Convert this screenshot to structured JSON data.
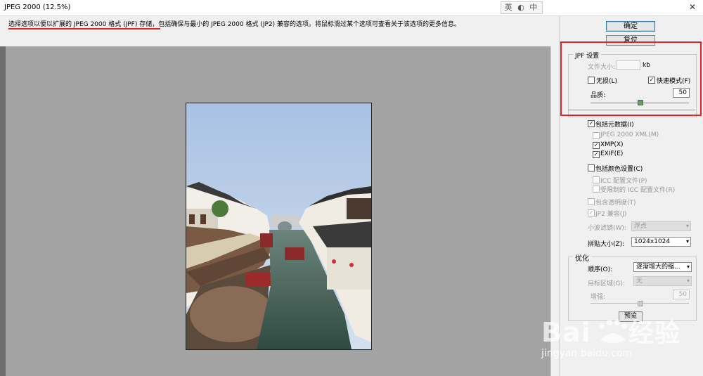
{
  "window": {
    "title": "JPEG 2000 (12.5%)",
    "ime_indicator": "英 ◐ 中",
    "close": "✕"
  },
  "hint_text": "选择选项以便以扩展的 JPEG 2000 格式 (JPF) 存储，包括确保与最小的 JPEG 2000 格式 (JP2) 兼容的选项。将鼠标滑过某个选项可查看关于该选项的更多信息。",
  "buttons": {
    "ok": "确定",
    "reset": "复位",
    "preview": "预览"
  },
  "jpf_settings": {
    "title": "JPF 设置",
    "file_size_label": "文件大小:",
    "file_size_value": "",
    "file_size_unit": "kb",
    "lossless_label": "无损(L)",
    "lossless_checked": false,
    "fast_mode_label": "快速模式(F)",
    "fast_mode_checked": true,
    "quality_label": "品质:",
    "quality_value": "50",
    "quality_level": 0.5
  },
  "metadata": {
    "include_metadata_label": "包括元数据(I)",
    "include_metadata_checked": true,
    "jpeg2000_xml_label": "JPEG 2000 XML(M)",
    "xmp_label": "XMP(X)",
    "xmp_checked": true,
    "exif_label": "EXIF(E)",
    "exif_checked": true
  },
  "color": {
    "include_color_label": "包括颜色设置(C)",
    "icc_profile_label": "ICC 配置文件(P)",
    "restricted_icc_label": "受限制的 ICC 配置文件(R)",
    "transparency_label": "包含透明度(T)",
    "jp2_compat_label": "JP2 兼容(J)",
    "jp2_compat_checked": true,
    "wavelet_label": "小波滤镜(W):",
    "wavelet_value": "浮点",
    "tile_size_label": "拼贴大小(Z):",
    "tile_size_value": "1024x1024"
  },
  "optimize": {
    "title": "优化",
    "order_label": "顺序(O):",
    "order_value": "逐渐增大的缩...",
    "roi_label": "目标区域(G):",
    "roi_value": "无",
    "enhance_label": "增强:",
    "enhance_value": "50",
    "enhance_level": 0.5
  },
  "watermark": {
    "logo": "Bai du 经验",
    "url": "jingyan.baidu.com"
  },
  "colors": {
    "highlight_red": "#e02424",
    "preview_bg": "#a3a3a3",
    "sky": "#bcd0e8",
    "water": "#3f5a4e"
  }
}
